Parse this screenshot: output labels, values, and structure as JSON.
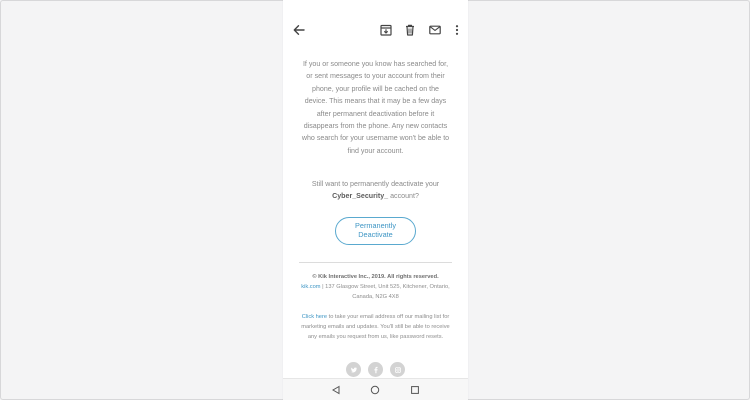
{
  "email": {
    "body_text": "If you or someone you know has searched for, or sent messages to your account from their phone, your profile will be cached on the device. This means that it may be a few days after permanent deactivation before it disappears from the phone. Any new contacts who search for your username won't be able to find your account.",
    "question_prefix": "Still want to permanently deactivate your",
    "username": "Cyber_Security_",
    "question_suffix": "account?",
    "cta_label": "Permanently Deactivate"
  },
  "footer": {
    "copyright": "© Kik Interactive Inc., 2019. All rights reserved.",
    "site_link": "kik.com",
    "address": "| 137 Glasgow Street, Unit 525, Kitchener, Ontario, Canada, N2G 4X8",
    "unsubscribe_link": "Click here",
    "unsubscribe_text": "to take your email address off our mailing list for marketing emails and updates. You'll still be able to receive any emails you request from us, like password resets."
  },
  "icons": {
    "toolbar": [
      "back-arrow-icon",
      "archive-icon",
      "delete-icon",
      "mail-icon",
      "more-vert-icon"
    ],
    "social": [
      "twitter-icon",
      "facebook-icon",
      "instagram-icon"
    ],
    "nav": [
      "back-triangle-icon",
      "home-circle-icon",
      "recents-square-icon"
    ]
  },
  "colors": {
    "accent": "#3d95c4",
    "text": "#8a8a8a",
    "background": "#f4f4f5"
  }
}
